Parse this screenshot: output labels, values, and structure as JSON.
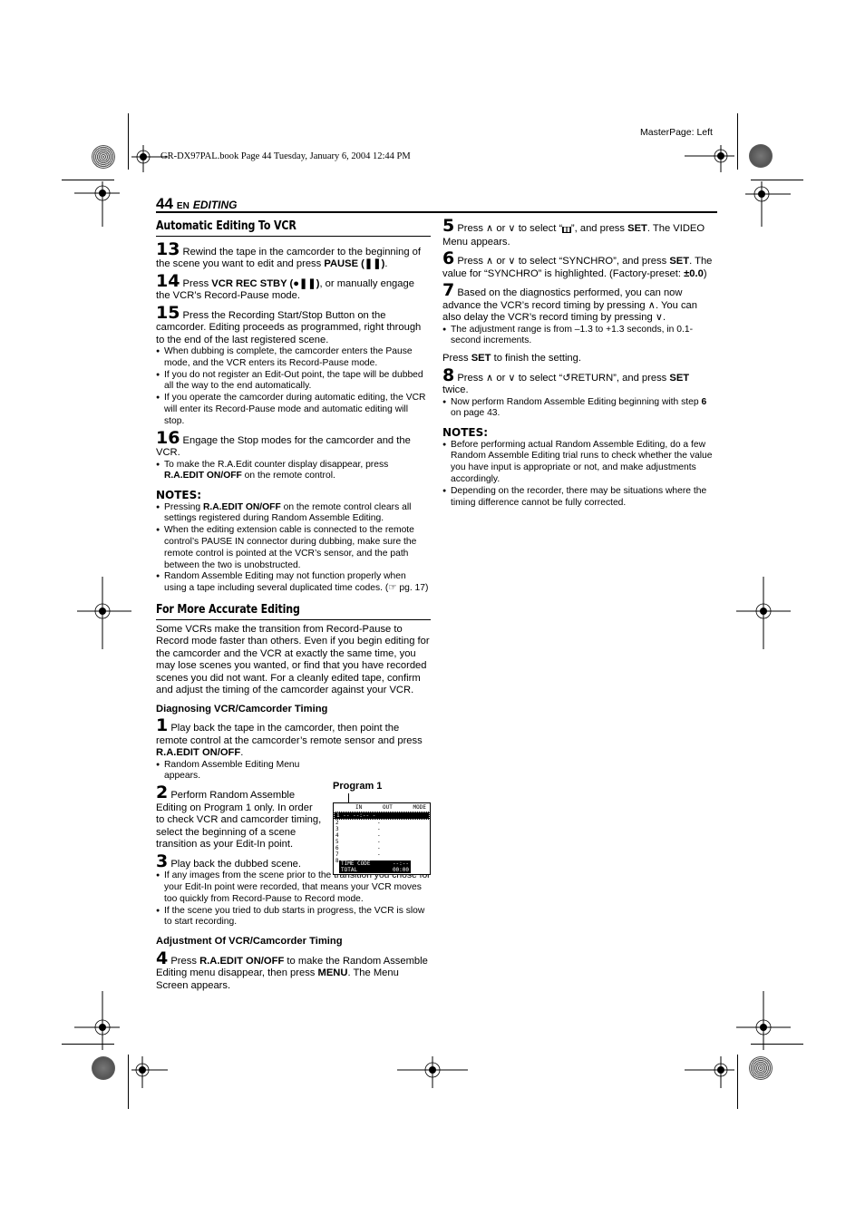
{
  "print_header": {
    "book_info": "GR-DX97PAL.book  Page 44  Tuesday, January 6, 2004  12:44 PM",
    "master_page": "MasterPage: Left"
  },
  "page_header": {
    "page_number": "44",
    "lang": "EN",
    "section": "EDITING"
  },
  "left_column": {
    "heading1": "Automatic Editing To VCR",
    "step13": {
      "num": "13",
      "text_a": " Rewind the tape in the camcorder to the beginning of the scene you want to edit and press ",
      "bold": "PAUSE (❚❚)",
      "text_b": "."
    },
    "step14": {
      "num": "14",
      "text_a": " Press ",
      "bold": "VCR REC STBY (●❚❚)",
      "text_b": ", or manually engage the VCR’s Record-Pause mode."
    },
    "step15": {
      "num": "15",
      "text": " Press the Recording Start/Stop Button on the camcorder. Editing proceeds as programmed, right through to the end of the last registered scene."
    },
    "step15_bullets": [
      "When dubbing is complete, the camcorder enters the Pause mode, and the VCR enters its Record-Pause mode.",
      "If you do not register an Edit-Out point, the tape will be dubbed all the way to the end automatically.",
      "If you operate the camcorder during automatic editing, the VCR will enter its Record-Pause mode and automatic editing will stop."
    ],
    "step16": {
      "num": "16",
      "text": " Engage the Stop modes for the camcorder and the VCR."
    },
    "step16_bullet": {
      "text_a": "To make the R.A.Edit counter display disappear, press ",
      "bold": "R.A.EDIT ON/OFF",
      "text_b": " on the remote control."
    },
    "notes_label": "NOTES:",
    "notes": {
      "n1_a": "Pressing ",
      "n1_bold": "R.A.EDIT ON/OFF",
      "n1_b": " on the remote control clears all settings registered during Random Assemble Editing.",
      "n2": "When the editing extension cable is connected to the remote control’s PAUSE IN connector during dubbing, make sure the remote control is pointed at the VCR’s sensor, and the path between the two is unobstructed.",
      "n3": "Random Assemble Editing may not function properly when using a tape including several duplicated time codes. (☞ pg. 17)"
    },
    "heading2": "For More Accurate Editing",
    "intro": "Some VCRs make the transition from Record-Pause to Record mode faster than others. Even if you begin editing for the camcorder and the VCR at exactly the same time, you may lose scenes you wanted, or find that you have recorded scenes you did not want. For a cleanly edited tape, confirm and adjust the timing of the camcorder against your VCR.",
    "sub1": "Diagnosing VCR/Camcorder Timing",
    "step1": {
      "num": "1",
      "text_a": " Play back the tape in the camcorder, then point the remote control at the camcorder’s remote sensor and press ",
      "bold": "R.A.EDIT ON/OFF",
      "text_b": "."
    },
    "step1_bullet": "Random Assemble Editing Menu appears.",
    "step2": {
      "num": "2",
      "text": " Perform Random Assemble Editing on Program 1 only. In order to check VCR and camcorder timing, select the beginning of a scene transition as your Edit-In point."
    },
    "step3": {
      "num": "3",
      "text": " Play back the dubbed scene."
    },
    "step3_bullets": [
      "If any images from the scene prior to the transition you chose for your Edit-In point were recorded, that means your VCR moves too quickly from Record-Pause to Record mode.",
      "If the scene you tried to dub starts in progress, the VCR is slow to start recording."
    ],
    "sub2": "Adjustment Of VCR/Camcorder Timing",
    "step4": {
      "num": "4",
      "text_a": " Press ",
      "bold": "R.A.EDIT ON/OFF",
      "text_b": " to make the Random Assemble Editing menu disappear, then press ",
      "bold2": "MENU",
      "text_c": ". The Menu Screen appears."
    }
  },
  "figure": {
    "label": "Program 1",
    "col_in": "IN",
    "col_out": "OUT",
    "col_mode": "MODE",
    "rows": [
      "1",
      "2",
      "3",
      "4",
      "5",
      "6",
      "7",
      "8"
    ],
    "row1_value": "-- --:-- -",
    "dash": "-",
    "time_code_label": "TIME CODE",
    "time_code_value": "--:--",
    "total_label": "TOTAL",
    "total_value": "00:00"
  },
  "right_column": {
    "step5": {
      "num": "5",
      "text_a": " Press ∧ or ∨ to select “",
      "icon": "▮▮",
      "text_b": "”, and press ",
      "bold": "SET",
      "text_c": ". The VIDEO Menu appears."
    },
    "step6": {
      "num": "6",
      "text_a": " Press ∧ or ∨ to select “SYNCHRO”, and press ",
      "bold": "SET",
      "text_b": ". The value for “SYNCHRO” is highlighted. (Factory-preset: ",
      "bold2": "±0.0",
      "text_c": ")"
    },
    "step7": {
      "num": "7",
      "text": " Based on the diagnostics performed, you can now advance the VCR’s record timing by pressing ∧. You can also delay the VCR’s record timing by pressing ∨."
    },
    "step7_bullet": "The adjustment range is from –1.3 to +1.3 seconds, in 0.1-second increments.",
    "press_set": {
      "text_a": "Press ",
      "bold": "SET",
      "text_b": " to finish the setting."
    },
    "step8": {
      "num": "8",
      "text_a": " Press ∧ or ∨ to select “↺RETURN”, and press ",
      "bold": "SET",
      "text_b": " twice."
    },
    "step8_bullet": {
      "text_a": "Now perform Random Assemble Editing beginning with step ",
      "bold": "6",
      "text_b": " on page 43."
    },
    "notes_label": "NOTES:",
    "notes": [
      "Before performing actual Random Assemble Editing, do a few Random Assemble Editing trial runs to check whether the value you have input is appropriate or not, and make adjustments accordingly.",
      "Depending on the recorder, there may be situations where the timing difference cannot be fully corrected."
    ]
  }
}
